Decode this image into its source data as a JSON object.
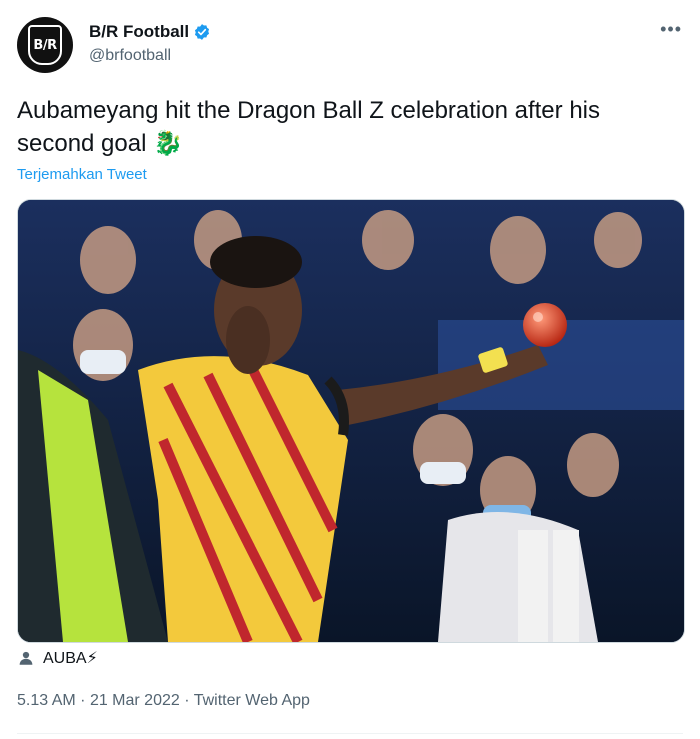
{
  "author": {
    "display_name": "B/R Football",
    "handle": "@brfootball",
    "avatar_text": "B/R"
  },
  "tweet": {
    "text": "Aubameyang hit the Dragon Ball Z celebration after his second goal",
    "emoji": "🐉",
    "translate_label": "Terjemahkan Tweet",
    "media_icon": "photo-image",
    "tagged_user": "AUBA⚡",
    "meta": {
      "time": "5.13 AM",
      "date": "21 Mar 2022",
      "source": "Twitter Web App"
    }
  },
  "colors": {
    "link": "#1d9bf0",
    "verified": "#1d9bf0",
    "secondary_text": "#536471"
  },
  "icons": {
    "more": "more-horizontal-icon",
    "verified": "verified-badge-icon",
    "tag": "person-icon"
  }
}
